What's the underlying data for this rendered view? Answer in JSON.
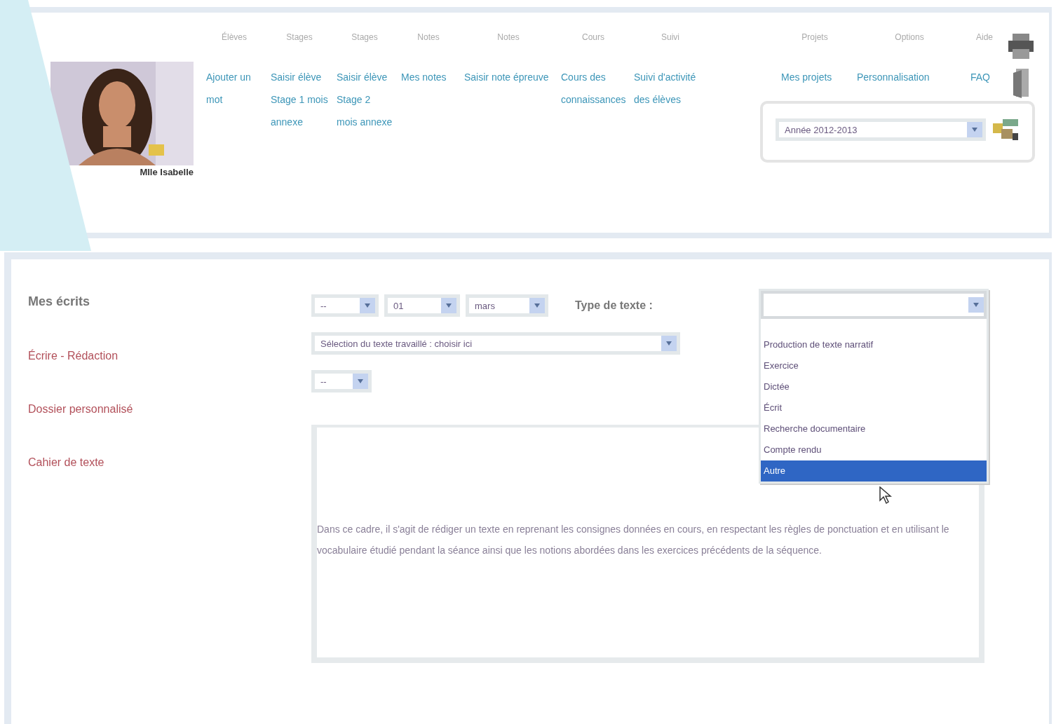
{
  "profile": {
    "name": "Mlle Isabelle"
  },
  "menu": [
    {
      "header": "Élèves",
      "link": "Ajouter un mot"
    },
    {
      "header": "Stages",
      "link": "Saisir élève Stage 1 mois annexe"
    },
    {
      "header": "Stages",
      "link": "Saisir élève Stage 2 mois annexe"
    },
    {
      "header": "Notes",
      "link": "Mes notes"
    },
    {
      "header": "Notes",
      "link": "Saisir note épreuve"
    },
    {
      "header": "Cours",
      "link": "Cours des connaissances"
    },
    {
      "header": "Suivi",
      "link": "Suivi d'activité des élèves"
    },
    {
      "header": "Projets",
      "link": "Mes projets"
    },
    {
      "header": "Options",
      "link": "Personnalisation"
    },
    {
      "header": "Aide",
      "link": "FAQ"
    }
  ],
  "year_select": {
    "value": "Année 2012-2013"
  },
  "sidebar": {
    "title": "Mes écrits",
    "links": [
      "Écrire - Rédaction",
      "Dossier personnalisé",
      "Cahier de texte"
    ]
  },
  "form": {
    "day": "--",
    "month": "01",
    "year": "mars",
    "type_label": "Type de texte :",
    "text_select": "Sélection du texte travaillé : choisir ici",
    "extra_select": "--",
    "body": "Dans ce cadre, il s'agit de rédiger un texte en reprenant les consignes données en cours, en respectant les règles de ponctuation et en utilisant le vocabulaire étudié pendant la séance ainsi que les notions abordées dans les exercices précédents de la séquence.",
    "dropdown": {
      "options": [
        {
          "label": "Production de texte narratif",
          "selected": false
        },
        {
          "label": "Exercice",
          "selected": false
        },
        {
          "label": "Dictée",
          "selected": false
        },
        {
          "label": "Écrit",
          "selected": false
        },
        {
          "label": "Recherche documentaire",
          "selected": false
        },
        {
          "label": "Compte rendu",
          "selected": false
        },
        {
          "label": "Autre",
          "selected": true
        }
      ]
    }
  }
}
